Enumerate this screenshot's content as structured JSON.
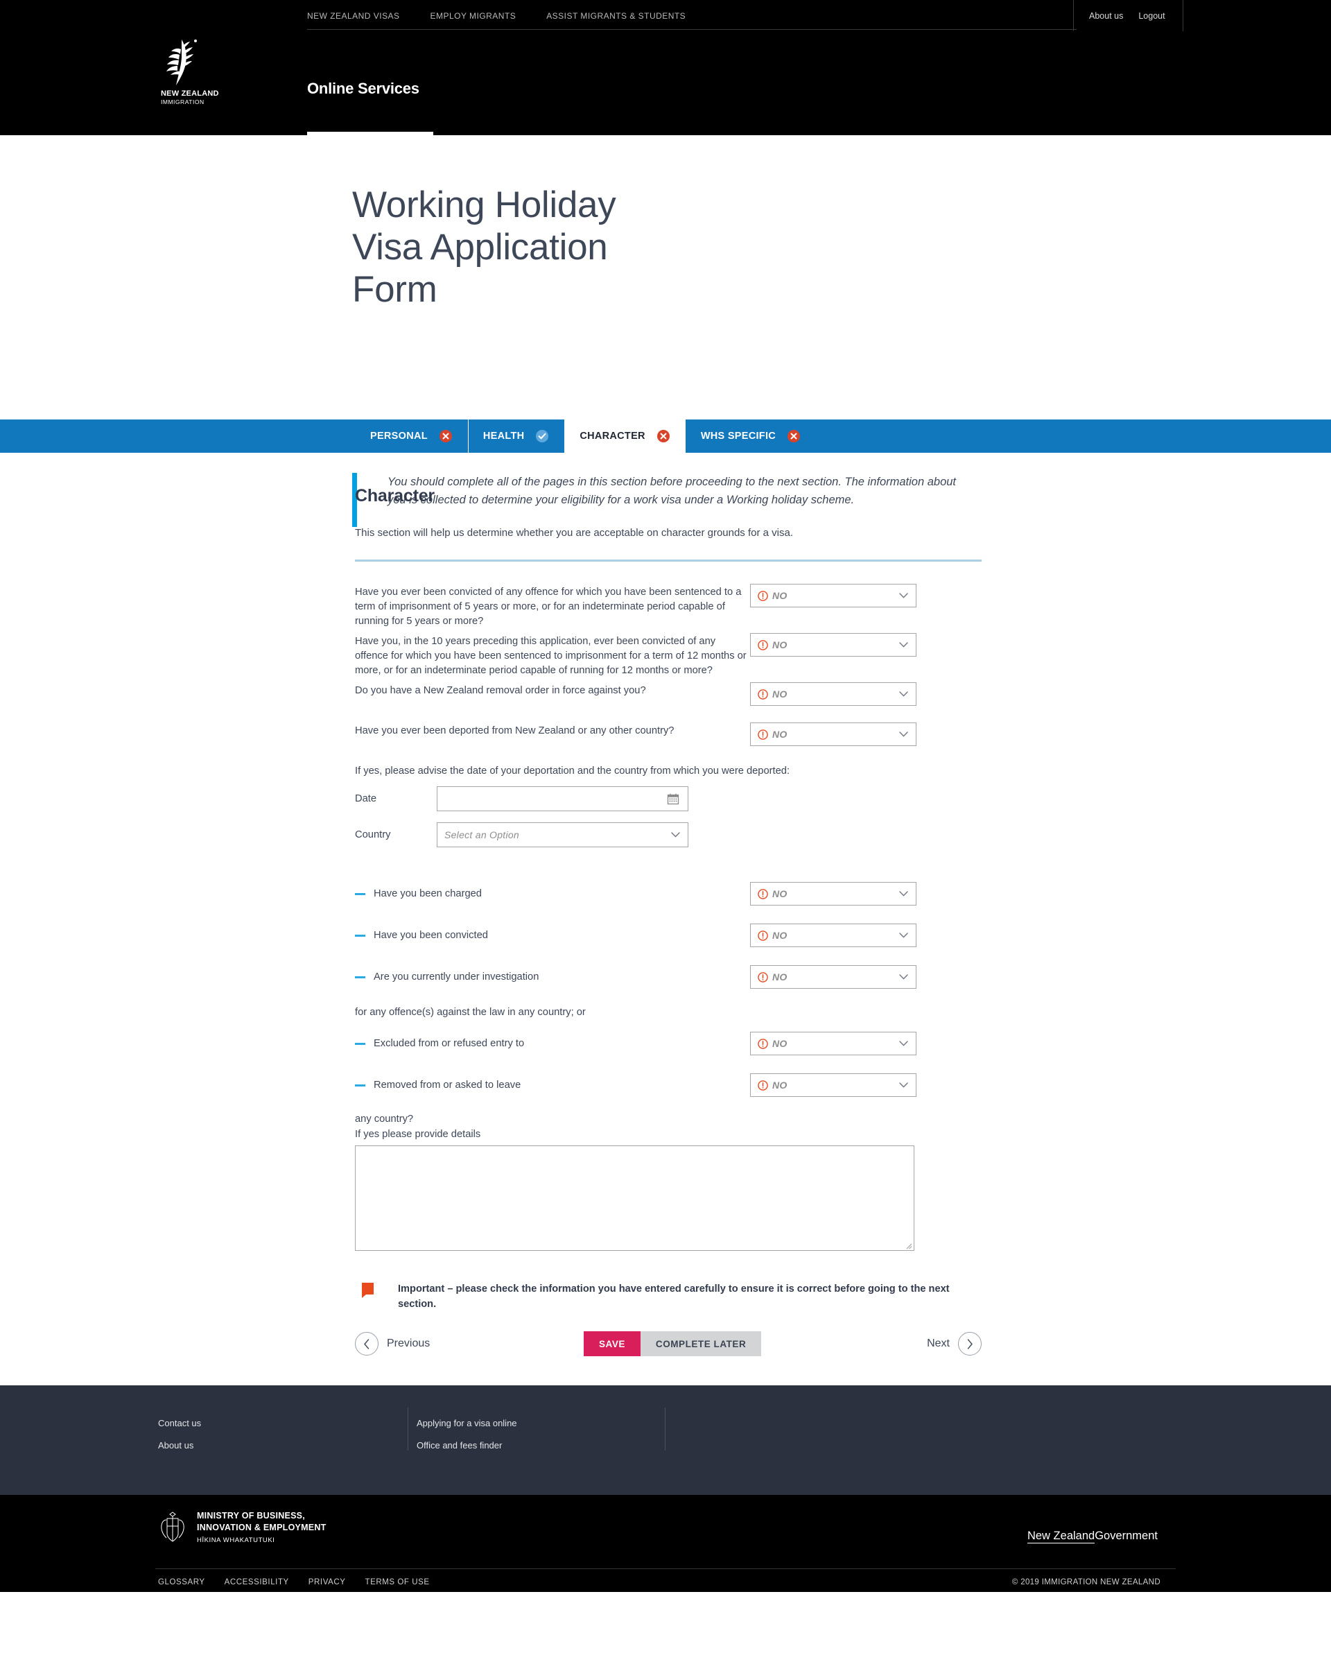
{
  "topnav": {
    "items": [
      {
        "label": "NEW ZEALAND VISAS"
      },
      {
        "label": "EMPLOY MIGRANTS"
      },
      {
        "label": "ASSIST MIGRANTS & STUDENTS"
      }
    ],
    "right": [
      {
        "label": "About us"
      },
      {
        "label": "Logout"
      }
    ]
  },
  "brand": {
    "logo_line1": "NEW ZEALAND",
    "logo_line2": "IMMIGRATION",
    "service_tab": "Online Services"
  },
  "hero": {
    "title": "Working Holiday\nVisa Application\nForm",
    "intro": "You should complete all of the pages in this section before proceeding to the next section. The information about you is collected to determine your eligibility for a work visa under a Working holiday scheme.",
    "accent_color": "#00a1de"
  },
  "tabs": [
    {
      "label": "PERSONAL",
      "status": "error",
      "active": false
    },
    {
      "label": "HEALTH",
      "status": "ok",
      "active": false
    },
    {
      "label": "CHARACTER",
      "status": "error",
      "active": true
    },
    {
      "label": "WHS SPECIFIC",
      "status": "error",
      "active": false
    }
  ],
  "section": {
    "heading": "Character",
    "subheading": "This section will help us determine whether you are acceptable on character grounds for a visa."
  },
  "questions": [
    {
      "text": "Have you ever been convicted of any offence for which you have been sentenced to a term of imprisonment of 5 years or more, or for an indeterminate period capable of running for 5 years or more?",
      "value": "NO"
    },
    {
      "text": "Have you, in the 10 years preceding this application, ever been convicted of any offence for which you have been sentenced to imprisonment for a term of 12 months or more, or for an indeterminate period capable of running for 12 months or more?",
      "value": "NO"
    },
    {
      "text": "Do you have a New Zealand removal order in force against you?",
      "value": "NO"
    },
    {
      "text": "Have you ever been deported from New Zealand or any other country?",
      "value": "NO"
    }
  ],
  "deportation": {
    "helper": "If yes, please advise the date of your deportation and the country from which you were deported:",
    "date_label": "Date",
    "date_value": "",
    "country_label": "Country",
    "country_placeholder": "Select an Option"
  },
  "bullets": [
    {
      "label": "Have you been charged",
      "value": "NO"
    },
    {
      "label": "Have you been convicted",
      "value": "NO"
    },
    {
      "label": "Are you currently under investigation",
      "value": "NO"
    }
  ],
  "mid_line": "for any offence(s) against the law in any country; or",
  "bullets2": [
    {
      "label": "Excluded from or refused entry to",
      "value": "NO"
    },
    {
      "label": "Removed from or asked to leave",
      "value": "NO"
    }
  ],
  "tail_line": "any country?",
  "details": {
    "label": "If yes please provide details",
    "value": ""
  },
  "important": {
    "text": "Important – please check the information you have entered carefully to ensure it is correct before going to the next section.",
    "icon_color": "#e8491d"
  },
  "actions": {
    "previous": "Previous",
    "save": "SAVE",
    "complete_later": "COMPLETE LATER",
    "next": "Next",
    "save_color": "#d81e5b",
    "later_color": "#d2d4d6"
  },
  "footer": {
    "col1": [
      {
        "label": "Contact us"
      },
      {
        "label": "About us"
      }
    ],
    "col2": [
      {
        "label": "Applying for a visa online"
      },
      {
        "label": "Office and fees finder"
      }
    ]
  },
  "govfooter": {
    "ministry_line1": "MINISTRY OF BUSINESS,",
    "ministry_line2": "INNOVATION & EMPLOYMENT",
    "ministry_maori": "HĪKINA WHAKATUTUKI",
    "nzg_underlined": "New Zealand",
    "nzg_rest": "Government",
    "legal": [
      {
        "label": "GLOSSARY"
      },
      {
        "label": "ACCESSIBILITY"
      },
      {
        "label": "PRIVACY"
      },
      {
        "label": "TERMS OF USE"
      }
    ],
    "copyright": "© 2019 IMMIGRATION NEW ZEALAND"
  }
}
